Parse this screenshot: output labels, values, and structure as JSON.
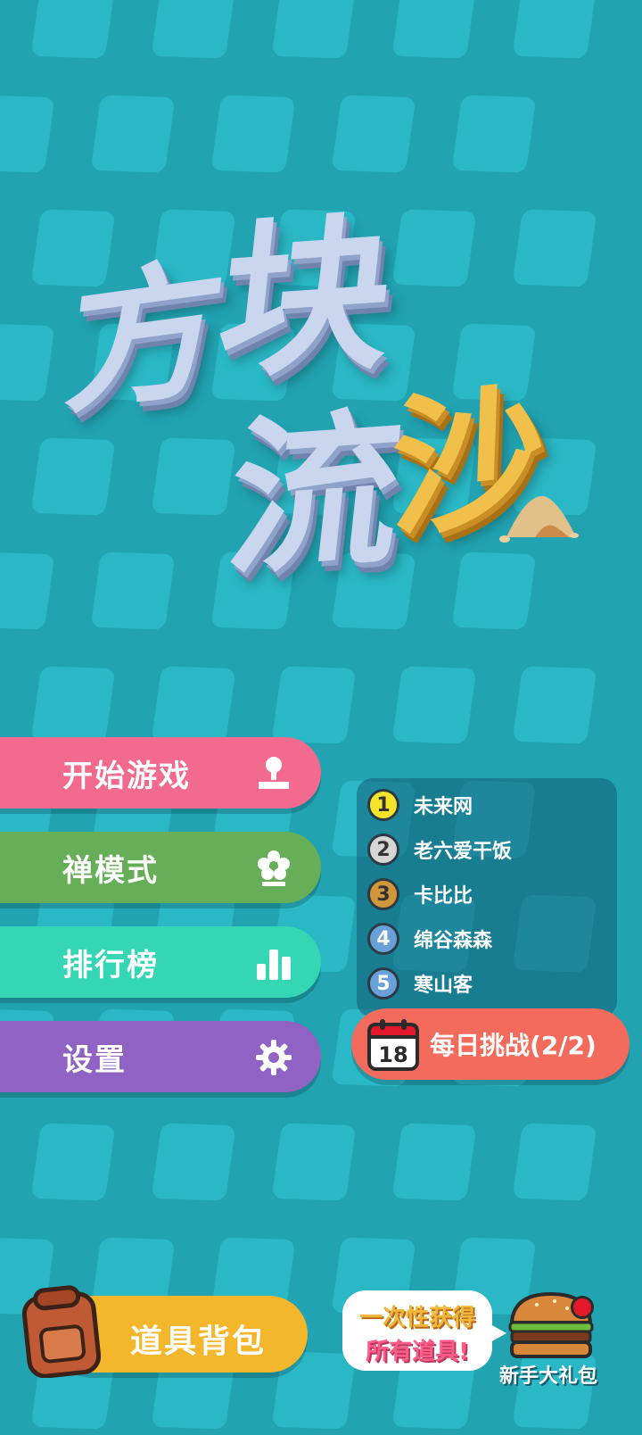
{
  "title": {
    "chars": [
      "方",
      "块",
      "流",
      "沙"
    ]
  },
  "menu": {
    "start": {
      "label": "开始游戏",
      "icon": "joystick-icon"
    },
    "zen": {
      "label": "禅模式",
      "icon": "flower-icon"
    },
    "rank": {
      "label": "排行榜",
      "icon": "bar-chart-icon"
    },
    "settings": {
      "label": "设置",
      "icon": "gear-icon"
    }
  },
  "leaderboard": [
    {
      "rank": "1",
      "name": "未来网",
      "color": "#f5e52a"
    },
    {
      "rank": "2",
      "name": "老六爱干饭",
      "color": "#d6d6d6"
    },
    {
      "rank": "3",
      "name": "卡比比",
      "color": "#d3973b"
    },
    {
      "rank": "4",
      "name": "绵谷森森",
      "color": "#6aa0d8"
    },
    {
      "rank": "5",
      "name": "寒山客",
      "color": "#6aa0d8"
    }
  ],
  "daily": {
    "calendar_day": "18",
    "label": "每日挑战(2/2)",
    "icon": "calendar-icon"
  },
  "bag": {
    "label": "道具背包",
    "icon": "backpack-icon"
  },
  "gift": {
    "bubble_line1": "一次性获得",
    "bubble_line2": "所有道具!",
    "label": "新手大礼包",
    "icon": "burger-icon"
  },
  "colors": {
    "background": "#21a3b2",
    "start": "#f26a8d",
    "zen": "#66ae57",
    "rank": "#35d6b3",
    "settings": "#8f62c4",
    "daily": "#f26b5c",
    "bag": "#f4b62a"
  }
}
